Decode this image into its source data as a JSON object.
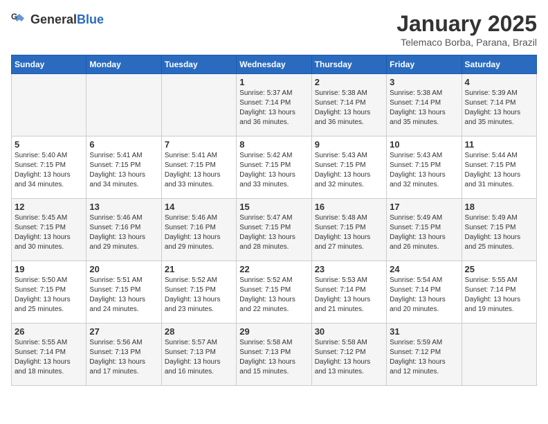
{
  "header": {
    "logo_general": "General",
    "logo_blue": "Blue",
    "title": "January 2025",
    "subtitle": "Telemaco Borba, Parana, Brazil"
  },
  "weekdays": [
    "Sunday",
    "Monday",
    "Tuesday",
    "Wednesday",
    "Thursday",
    "Friday",
    "Saturday"
  ],
  "weeks": [
    [
      {
        "day": "",
        "info": ""
      },
      {
        "day": "",
        "info": ""
      },
      {
        "day": "",
        "info": ""
      },
      {
        "day": "1",
        "info": "Sunrise: 5:37 AM\nSunset: 7:14 PM\nDaylight: 13 hours\nand 36 minutes."
      },
      {
        "day": "2",
        "info": "Sunrise: 5:38 AM\nSunset: 7:14 PM\nDaylight: 13 hours\nand 36 minutes."
      },
      {
        "day": "3",
        "info": "Sunrise: 5:38 AM\nSunset: 7:14 PM\nDaylight: 13 hours\nand 35 minutes."
      },
      {
        "day": "4",
        "info": "Sunrise: 5:39 AM\nSunset: 7:14 PM\nDaylight: 13 hours\nand 35 minutes."
      }
    ],
    [
      {
        "day": "5",
        "info": "Sunrise: 5:40 AM\nSunset: 7:15 PM\nDaylight: 13 hours\nand 34 minutes."
      },
      {
        "day": "6",
        "info": "Sunrise: 5:41 AM\nSunset: 7:15 PM\nDaylight: 13 hours\nand 34 minutes."
      },
      {
        "day": "7",
        "info": "Sunrise: 5:41 AM\nSunset: 7:15 PM\nDaylight: 13 hours\nand 33 minutes."
      },
      {
        "day": "8",
        "info": "Sunrise: 5:42 AM\nSunset: 7:15 PM\nDaylight: 13 hours\nand 33 minutes."
      },
      {
        "day": "9",
        "info": "Sunrise: 5:43 AM\nSunset: 7:15 PM\nDaylight: 13 hours\nand 32 minutes."
      },
      {
        "day": "10",
        "info": "Sunrise: 5:43 AM\nSunset: 7:15 PM\nDaylight: 13 hours\nand 32 minutes."
      },
      {
        "day": "11",
        "info": "Sunrise: 5:44 AM\nSunset: 7:15 PM\nDaylight: 13 hours\nand 31 minutes."
      }
    ],
    [
      {
        "day": "12",
        "info": "Sunrise: 5:45 AM\nSunset: 7:15 PM\nDaylight: 13 hours\nand 30 minutes."
      },
      {
        "day": "13",
        "info": "Sunrise: 5:46 AM\nSunset: 7:16 PM\nDaylight: 13 hours\nand 29 minutes."
      },
      {
        "day": "14",
        "info": "Sunrise: 5:46 AM\nSunset: 7:16 PM\nDaylight: 13 hours\nand 29 minutes."
      },
      {
        "day": "15",
        "info": "Sunrise: 5:47 AM\nSunset: 7:15 PM\nDaylight: 13 hours\nand 28 minutes."
      },
      {
        "day": "16",
        "info": "Sunrise: 5:48 AM\nSunset: 7:15 PM\nDaylight: 13 hours\nand 27 minutes."
      },
      {
        "day": "17",
        "info": "Sunrise: 5:49 AM\nSunset: 7:15 PM\nDaylight: 13 hours\nand 26 minutes."
      },
      {
        "day": "18",
        "info": "Sunrise: 5:49 AM\nSunset: 7:15 PM\nDaylight: 13 hours\nand 25 minutes."
      }
    ],
    [
      {
        "day": "19",
        "info": "Sunrise: 5:50 AM\nSunset: 7:15 PM\nDaylight: 13 hours\nand 25 minutes."
      },
      {
        "day": "20",
        "info": "Sunrise: 5:51 AM\nSunset: 7:15 PM\nDaylight: 13 hours\nand 24 minutes."
      },
      {
        "day": "21",
        "info": "Sunrise: 5:52 AM\nSunset: 7:15 PM\nDaylight: 13 hours\nand 23 minutes."
      },
      {
        "day": "22",
        "info": "Sunrise: 5:52 AM\nSunset: 7:15 PM\nDaylight: 13 hours\nand 22 minutes."
      },
      {
        "day": "23",
        "info": "Sunrise: 5:53 AM\nSunset: 7:14 PM\nDaylight: 13 hours\nand 21 minutes."
      },
      {
        "day": "24",
        "info": "Sunrise: 5:54 AM\nSunset: 7:14 PM\nDaylight: 13 hours\nand 20 minutes."
      },
      {
        "day": "25",
        "info": "Sunrise: 5:55 AM\nSunset: 7:14 PM\nDaylight: 13 hours\nand 19 minutes."
      }
    ],
    [
      {
        "day": "26",
        "info": "Sunrise: 5:55 AM\nSunset: 7:14 PM\nDaylight: 13 hours\nand 18 minutes."
      },
      {
        "day": "27",
        "info": "Sunrise: 5:56 AM\nSunset: 7:13 PM\nDaylight: 13 hours\nand 17 minutes."
      },
      {
        "day": "28",
        "info": "Sunrise: 5:57 AM\nSunset: 7:13 PM\nDaylight: 13 hours\nand 16 minutes."
      },
      {
        "day": "29",
        "info": "Sunrise: 5:58 AM\nSunset: 7:13 PM\nDaylight: 13 hours\nand 15 minutes."
      },
      {
        "day": "30",
        "info": "Sunrise: 5:58 AM\nSunset: 7:12 PM\nDaylight: 13 hours\nand 13 minutes."
      },
      {
        "day": "31",
        "info": "Sunrise: 5:59 AM\nSunset: 7:12 PM\nDaylight: 13 hours\nand 12 minutes."
      },
      {
        "day": "",
        "info": ""
      }
    ]
  ]
}
